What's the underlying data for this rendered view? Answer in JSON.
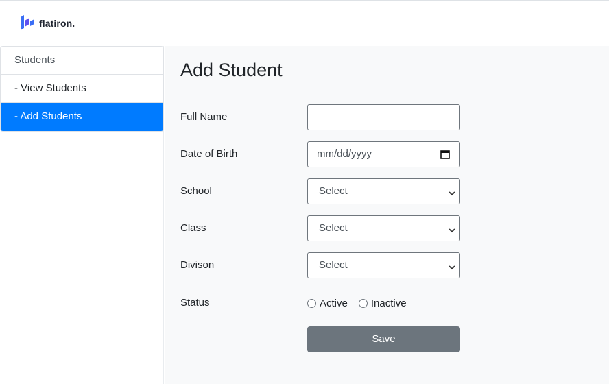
{
  "brand": {
    "name": "flatiron",
    "dot": "."
  },
  "sidebar": {
    "items": [
      {
        "label": "Students"
      },
      {
        "label": "- View Students"
      },
      {
        "label": "- Add Students"
      }
    ]
  },
  "main": {
    "title": "Add Student",
    "form": {
      "full_name": {
        "label": "Full Name",
        "value": ""
      },
      "dob": {
        "label": "Date of Birth",
        "placeholder": "mm/dd/yyyy"
      },
      "school": {
        "label": "School",
        "selected": "Select"
      },
      "class": {
        "label": "Class",
        "selected": "Select"
      },
      "division": {
        "label": "Divison",
        "selected": "Select"
      },
      "status": {
        "label": "Status",
        "options": [
          "Active",
          "Inactive"
        ]
      },
      "save_label": "Save"
    }
  },
  "colors": {
    "accent": "#007bff",
    "save_button": "#6c757d",
    "logo": "#5b50f0"
  }
}
